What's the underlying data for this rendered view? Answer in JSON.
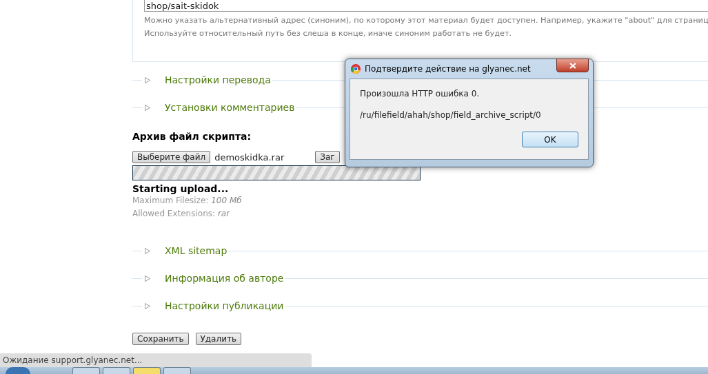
{
  "alias_field": {
    "value": "shop/sait-skidok"
  },
  "alias_help": [
    "Можно указать альтернативный адрес (синоним), по которому этот материал будет доступен. Например, укажите \"about\" для страниц",
    "Используйте относительный путь без слеша в конце, иначе синоним работать не будет."
  ],
  "sections_top": [
    {
      "label": "Настройки перевода",
      "expanded": false
    },
    {
      "label": "Установки комментариев",
      "expanded": false
    }
  ],
  "upload": {
    "heading": "Архив файл скрипта:",
    "choose_button": "Выберите файл",
    "file_name": "demoskidka.rar",
    "upload_button": "Заг",
    "level": 1,
    "status": "Starting upload...",
    "max_size_label": "Maximum Filesize:",
    "max_size": "100 Мб",
    "extensions_label": "Allowed Extensions:",
    "extensions": "rar"
  },
  "sections_bottom": [
    {
      "label": "XML sitemap",
      "expanded": false
    },
    {
      "label": "Информация об авторе",
      "expanded": false
    },
    {
      "label": "Настройки публикации",
      "expanded": false
    }
  ],
  "buttons": [
    "Сохранить",
    "Удалить"
  ],
  "status_bar": "Ожидание support.glyanec.net...",
  "dialog": {
    "title": "Подтвердите действие на glyanec.net",
    "message": "Произошла HTTP ошибка 0.",
    "path": "/ru/filefield/ahah/shop/field_archive_script/0",
    "ok": "OK"
  }
}
